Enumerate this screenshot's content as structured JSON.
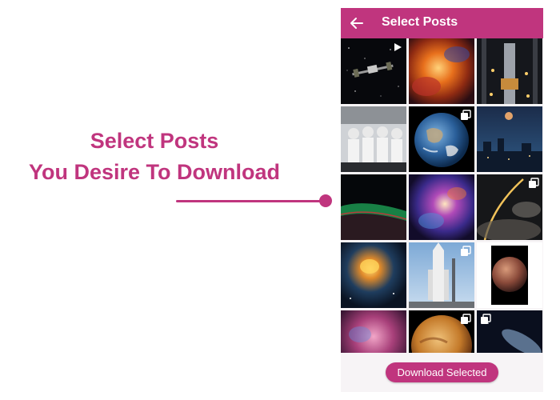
{
  "promo": {
    "line1": "Select Posts",
    "line2": "You Desire To Download",
    "accent_color": "#c0357e"
  },
  "app": {
    "title": "Select Posts",
    "back_icon": "arrow-left-icon",
    "bar_color": "#c0357e"
  },
  "posts": [
    {
      "name": "space-station",
      "badge": "video"
    },
    {
      "name": "orange-nebula",
      "badge": "none"
    },
    {
      "name": "rocket-hangar",
      "badge": "none"
    },
    {
      "name": "astronaut-crew",
      "badge": "none"
    },
    {
      "name": "earth-globe",
      "badge": "multiple"
    },
    {
      "name": "moon-over-city",
      "badge": "none"
    },
    {
      "name": "aurora-horizon",
      "badge": "none"
    },
    {
      "name": "purple-nebula",
      "badge": "none"
    },
    {
      "name": "rocket-launch-trail",
      "badge": "multiple"
    },
    {
      "name": "golden-galaxy",
      "badge": "none"
    },
    {
      "name": "rocket-on-pad",
      "badge": "multiple"
    },
    {
      "name": "red-planet",
      "badge": "none"
    },
    {
      "name": "pink-nebula",
      "badge": "none"
    },
    {
      "name": "venus-surface",
      "badge": "multiple"
    },
    {
      "name": "blue-galaxy",
      "badge": "multiple"
    }
  ],
  "download_button": {
    "label": "Download Selected"
  }
}
